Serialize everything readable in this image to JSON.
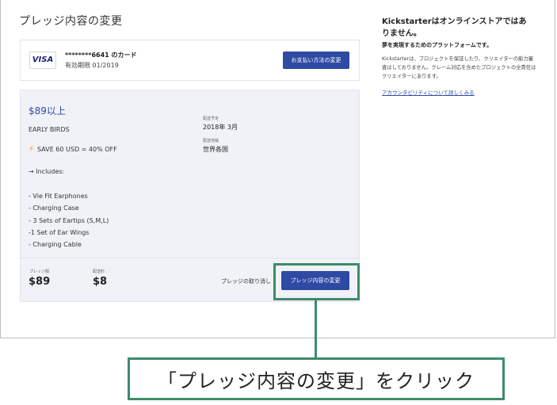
{
  "page": {
    "title": "プレッジ内容の変更"
  },
  "payment": {
    "brand": "VISA",
    "card_number": "********6641 のカード",
    "expiry": "有効期限 01/2019",
    "change_button": "お支払い方法の変更"
  },
  "reward": {
    "price": "$89以上",
    "title": "EARLY BIRDS",
    "save": "SAVE 60 USD = 40% OFF",
    "includes": "→ Includes:",
    "items": [
      "- Vie Fit Earphones",
      "- Charging Case",
      "- 3 Sets of Eartips (S,M,L)",
      "-1 Set of Ear Wings",
      "- Charging Cable"
    ],
    "delivery_label": "配送予定",
    "delivery_value": "2018年 3月",
    "ships_to_label": "配送地域",
    "ships_to_value": "世界各国"
  },
  "summary": {
    "pledge_label": "プレッジ額",
    "pledge_value": "$89",
    "shipping_label": "配送料",
    "shipping_value": "$8",
    "cancel_link": "プレッジの取り消し",
    "change_button": "プレッジ内容の変更"
  },
  "sidebar": {
    "heading": "Kickstarterはオンラインストアではありません。",
    "subheading": "夢を実現するためのプラットフォームです。",
    "body": "Kickstarterは、プロジェクトを保証したり、クリエイターの能力審査はしておりません。クレーム対応を含めたプロジェクトの全責任はクリエイターにあります。",
    "link": "アカウンタビリティについて詳しくみる"
  },
  "callout": {
    "text": "「プレッジ内容の変更」をクリック"
  },
  "colors": {
    "accent": "#2f4aa3",
    "callout": "#3e8b6a",
    "panel": "#f0f2f7"
  },
  "icons": {
    "save": "lightning-icon"
  }
}
